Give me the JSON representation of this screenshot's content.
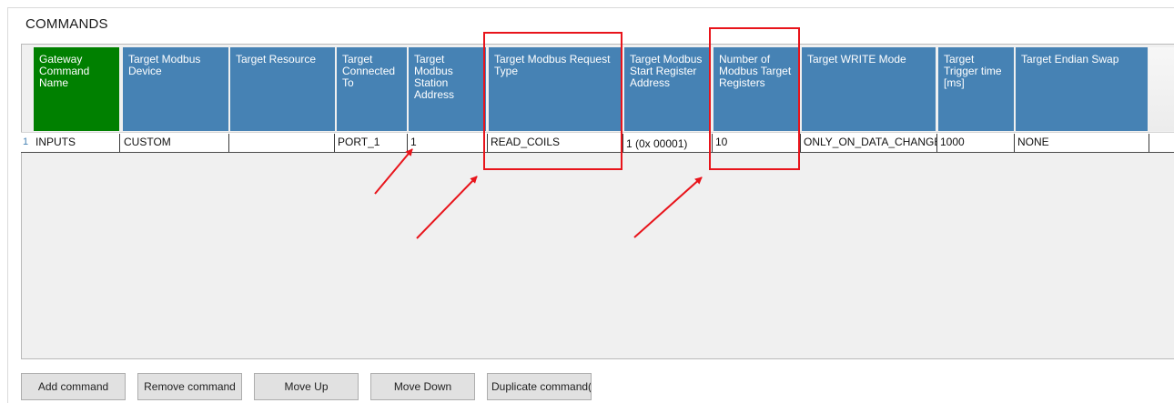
{
  "section": {
    "title": "COMMANDS"
  },
  "table": {
    "headers": [
      "Gateway Command Name",
      "Target Modbus Device",
      "Target Resource",
      "Target Connected To",
      "Target Modbus Station Address",
      "Target Modbus Request Type",
      "Target Modbus Start Register Address",
      "Number of Modbus Target Registers",
      "Target WRITE Mode",
      "Target Trigger time [ms]",
      "Target Endian Swap"
    ],
    "rows": [
      {
        "num": "1",
        "cells": [
          "INPUTS",
          "CUSTOM",
          "",
          "PORT_1",
          "1",
          "READ_COILS",
          "1 (0x 00001)",
          "10",
          "ONLY_ON_DATA_CHANGE",
          "1000",
          "NONE"
        ]
      }
    ]
  },
  "buttons": {
    "add": "Add command",
    "remove": "Remove command",
    "move_up": "Move Up",
    "move_down": "Move Down",
    "duplicate": "Duplicate command(s"
  },
  "colors": {
    "header_blue": "#4682b4",
    "header_green": "#008000",
    "annotation_red": "#e8141b"
  }
}
